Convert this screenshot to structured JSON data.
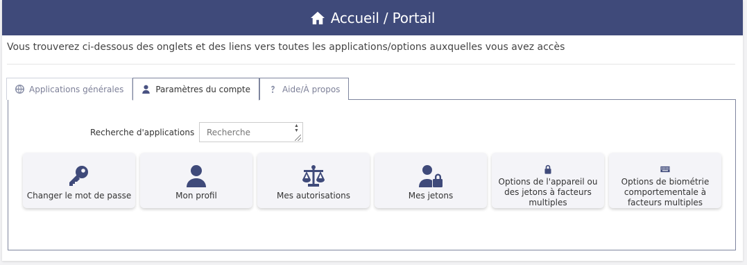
{
  "header": {
    "title": "Accueil / Portail",
    "icon": "home-icon",
    "bg_color": "#3f4a7a"
  },
  "intro_text": "Vous trouverez ci-dessous des onglets et des liens vers toutes les applications/options auxquelles vous avez accès",
  "tabs": [
    {
      "label": "Applications générales",
      "icon": "globe-icon",
      "active": false
    },
    {
      "label": "Paramètres du compte",
      "icon": "user-icon",
      "active": true
    },
    {
      "label": "Aide/À propos",
      "icon": "question-icon",
      "active": false
    }
  ],
  "search": {
    "label": "Recherche d'applications",
    "placeholder": "Recherche"
  },
  "tiles": [
    {
      "label": "Changer le mot de passe",
      "icon": "key-icon"
    },
    {
      "label": "Mon profil",
      "icon": "user-icon"
    },
    {
      "label": "Mes autorisations",
      "icon": "balance-scale-icon"
    },
    {
      "label": "Mes jetons",
      "icon": "user-lock-icon"
    },
    {
      "label": "Options de l'appareil ou des jetons à facteurs multiples",
      "icon": "lock-icon"
    },
    {
      "label": "Options de biométrie comportementale à facteurs multiples",
      "icon": "keyboard-icon"
    }
  ]
}
